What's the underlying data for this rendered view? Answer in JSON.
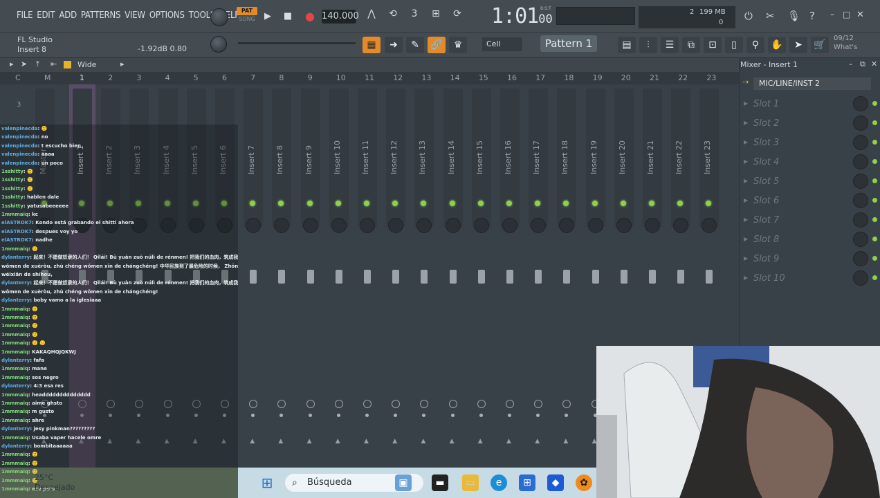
{
  "menu": [
    "FILE",
    "EDIT",
    "ADD",
    "PATTERNS",
    "VIEW",
    "OPTIONS",
    "TOOLS",
    "HELP"
  ],
  "transport": {
    "pat_label": "PAT",
    "song_label": "SONG",
    "bpm": "140.000",
    "time_main": "1:01",
    "time_small": "00",
    "bst": "B:S:T"
  },
  "cpu": {
    "value": "2",
    "ram": "199 MB",
    "voices": "0"
  },
  "hint": {
    "line1": "FL Studio",
    "line2": "Insert 8",
    "db": "-1.92dB",
    "pan": "0.80"
  },
  "toolbar2": {
    "cell_label": "Cell",
    "pattern_label": "Pattern 1",
    "news_date": "09/12",
    "news_text": "What's"
  },
  "mixer": {
    "view_label": "Wide",
    "ruler": [
      "C",
      "M",
      "1",
      "2",
      "3",
      "4",
      "5",
      "6",
      "7",
      "8",
      "9",
      "10",
      "11",
      "12",
      "13",
      "14",
      "15",
      "16",
      "17",
      "18",
      "19",
      "20",
      "21",
      "22",
      "23"
    ],
    "tracks": [
      "Master",
      "Insert 1",
      "Insert 2",
      "Insert 3",
      "Insert 4",
      "Insert 5",
      "Insert 6",
      "Insert 7",
      "Insert 8",
      "Insert 9",
      "Insert 10",
      "Insert 11",
      "Insert 12",
      "Insert 13",
      "Insert 14",
      "Insert 15",
      "Insert 16",
      "Insert 17",
      "Insert 18",
      "Insert 19",
      "Insert 20",
      "Insert 21",
      "Insert 22",
      "Insert 23"
    ],
    "current_label": "3"
  },
  "panel": {
    "title": "Mixer - Insert 1",
    "input": "MIC/LINE/INST 2",
    "slots": [
      "Slot 1",
      "Slot 2",
      "Slot 3",
      "Slot 4",
      "Slot 5",
      "Slot 6",
      "Slot 7",
      "Slot 8",
      "Slot 9",
      "Slot 10"
    ]
  },
  "chat": [
    {
      "user": "valenpinecda",
      "msg": ": 🙂"
    },
    {
      "user": "valenpinecda",
      "msg": ": no"
    },
    {
      "user": "valenpinecda",
      "msg": ": t escucho bien"
    },
    {
      "user": "valenpinecda",
      "msg": ": aaaa"
    },
    {
      "user": "valenpinecda",
      "msg": ": un poco"
    },
    {
      "user": "1sshitty",
      "msg": ": 🙂"
    },
    {
      "user": "1sshitty",
      "msg": ": 🙂"
    },
    {
      "user": "1sshitty",
      "msg": ": 🙂"
    },
    {
      "user": "1sshitty",
      "msg": ": hablen dale"
    },
    {
      "user": "1sshitty",
      "msg": ": yatusabeeeeee"
    },
    {
      "user": "1mmmaiq",
      "msg": ": kc"
    },
    {
      "user": "elASTROK7",
      "msg": ": Kondo está grabando el shitti ahora"
    },
    {
      "user": "elASTROK7",
      "msg": ": despues voy yo"
    },
    {
      "user": "elASTROK7",
      "msg": ": nadhe"
    },
    {
      "user": "1mmmaiq",
      "msg": ": 🙂"
    },
    {
      "user": "dylanterry",
      "msg": ": 起来！不愿做奴隶的人们！ Qǐlái! Bù yuàn zuò núlì de rénmen! 把我们的血肉，筑成我们新的长城！ Bǎ"
    },
    {
      "user": "",
      "msg": "wǒmen de xuèròu, zhù chéng wǒmen xīn de chángchéng! 中华民族到了最危险的时候， Zhōnghuá mínzú dàole zuì"
    },
    {
      "user": "",
      "msg": "wéixiǎn de shíhou,"
    },
    {
      "user": "dylanterry",
      "msg": ": 起来！不愿做奴隶的人们！ Qǐlái! Bù yuàn zuò núlì de rénmen! 把我们的血肉，筑成我们新的长城！ Bǎ"
    },
    {
      "user": "",
      "msg": "wǒmen de xuèròu, zhù chéng wǒmen xīn de chángchéng!"
    },
    {
      "user": "dylanterry",
      "msg": ": boby vamo a la iglesiaaa"
    },
    {
      "user": "1mmmaiq",
      "msg": ": 🙂"
    },
    {
      "user": "1mmmaiq",
      "msg": ": 🙂"
    },
    {
      "user": "1mmmaiq",
      "msg": ": 🙂"
    },
    {
      "user": "1mmmaiq",
      "msg": ": 🙂"
    },
    {
      "user": "1mmmaiq",
      "msg": ": 🙂 🙂"
    },
    {
      "user": "1mmmaiq",
      "msg": ": KAKAQHQJQKWJ"
    },
    {
      "user": "dylanterry",
      "msg": ": fafa"
    },
    {
      "user": "1mmmaiq",
      "msg": ": mane"
    },
    {
      "user": "1mmmaiq",
      "msg": ": sos negro"
    },
    {
      "user": "dylanterry",
      "msg": ": 4:3 esa res"
    },
    {
      "user": "1mmmaiq",
      "msg": ": headddddddddddddd"
    },
    {
      "user": "1mmmaiq",
      "msg": ": aime ghsto"
    },
    {
      "user": "1mmmaiq",
      "msg": ": m gusto"
    },
    {
      "user": "1mmmaiq",
      "msg": ": ahre"
    },
    {
      "user": "dylanterry",
      "msg": ": jesy pinkman?????????"
    },
    {
      "user": "1mmmaiq",
      "msg": ": Usaba vaper hacele omre"
    },
    {
      "user": "dylanterry",
      "msg": ": bombitaaaaaa"
    },
    {
      "user": "1mmmaiq",
      "msg": ": 🙂"
    },
    {
      "user": "1mmmaiq",
      "msg": ": 🙂"
    },
    {
      "user": "1mmmaiq",
      "msg": ": 🙂"
    },
    {
      "user": "1mmmaiq",
      "msg": ": 🙂"
    },
    {
      "user": "1mmmaiq",
      "msg": ": ese pelo"
    }
  ],
  "taskbar": {
    "search_placeholder": "Búsqueda",
    "temp": "25°C",
    "weather": "Despejado"
  },
  "colors": {
    "accent": "#e38b2b",
    "led_green": "#8fd14f",
    "bg": "#394148"
  }
}
